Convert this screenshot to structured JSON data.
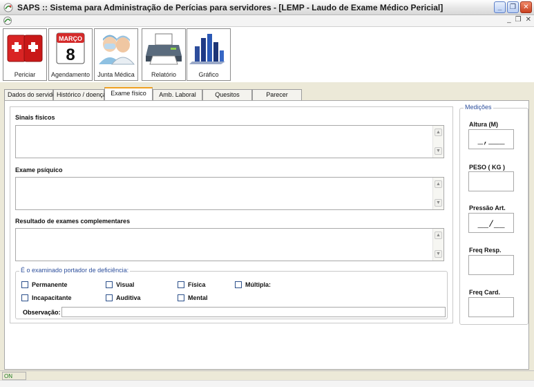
{
  "window": {
    "title": "SAPS :: Sistema para Administração de Perícias para servidores - [LEMP - Laudo de Exame Médico Pericial]"
  },
  "toolbar": {
    "buttons": [
      {
        "label": "Periciar",
        "icon": "first-aid-icon"
      },
      {
        "label": "Agendamento",
        "icon": "calendar-icon",
        "calendar_month": "MARÇO",
        "calendar_day": "8"
      },
      {
        "label": "Junta Médica",
        "icon": "doctors-icon"
      },
      {
        "label": "Relatório",
        "icon": "printer-icon"
      },
      {
        "label": "Gráfico",
        "icon": "bar-chart-icon"
      }
    ]
  },
  "tabs": [
    {
      "label": "Dados do servidor",
      "active": false
    },
    {
      "label": "Histórico / doença",
      "active": false
    },
    {
      "label": "Exame físico",
      "active": true
    },
    {
      "label": "Amb. Laboral",
      "active": false
    },
    {
      "label": "Quesitos",
      "active": false
    },
    {
      "label": "Parecer",
      "active": false
    }
  ],
  "form": {
    "sinais_label": "Sinais físicos",
    "psiquico_label": "Exame psíquico",
    "resultado_label": "Resultado de exames complementares",
    "deficiencia_legend": "É o examinado portador de deficiência:",
    "checkboxes": {
      "permanente": "Permanente",
      "visual": "Visual",
      "fisica": "Física",
      "multipla": "Múltipla:",
      "incapacitante": "Incapacitante",
      "auditiva": "Auditiva",
      "mental": "Mental"
    },
    "observacao_label": "Observação:"
  },
  "medicoes": {
    "legend": "Medições",
    "altura_label": "Altura (M)",
    "altura_mask": "_,___",
    "peso_label": "PESO ( KG )",
    "pressao_label": "Pressão Art.",
    "pressao_mask": "__/__",
    "freq_resp_label": "Freq Resp.",
    "freq_card_label": "Freq Card."
  },
  "status": {
    "connection": "ON LINE"
  }
}
